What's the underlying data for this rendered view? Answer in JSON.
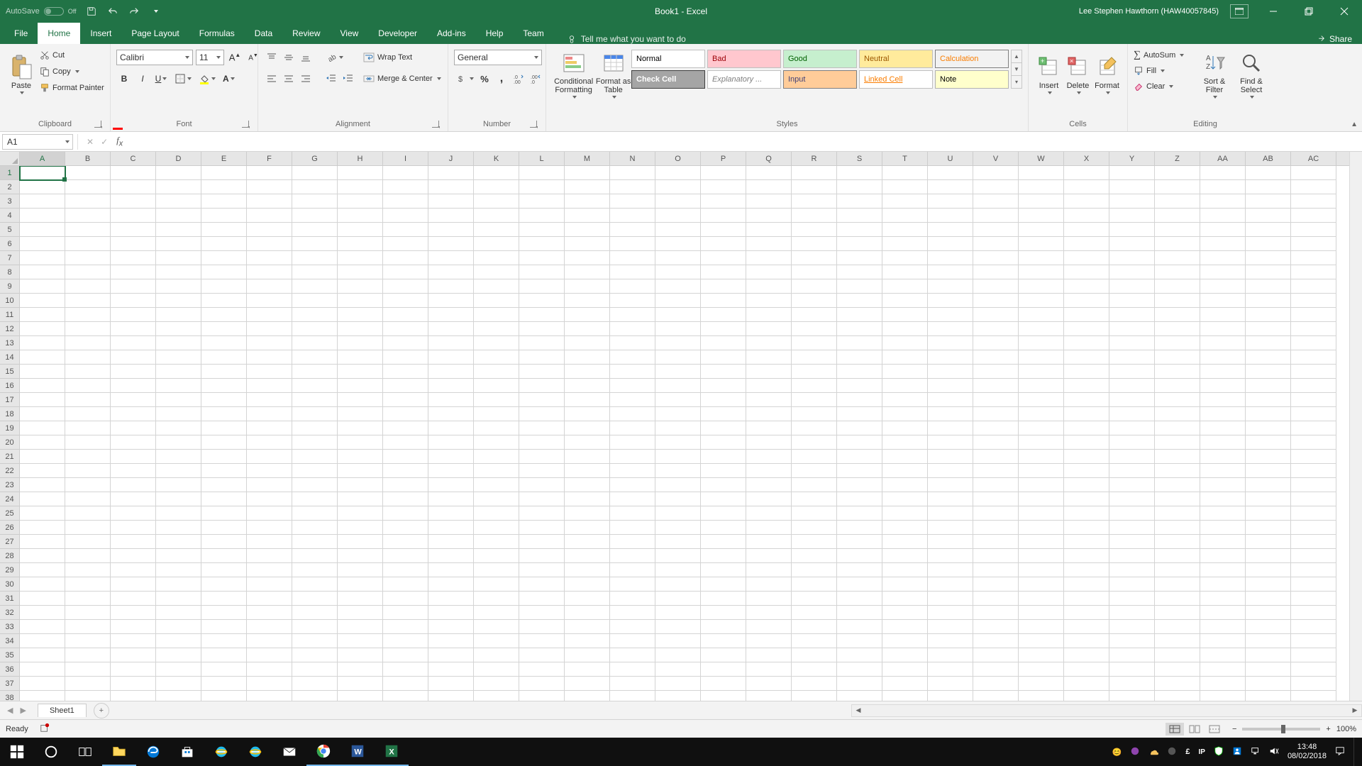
{
  "titlebar": {
    "autosave_label": "AutoSave",
    "autosave_state": "Off",
    "doc_title": "Book1 - Excel",
    "user": "Lee Stephen Hawthorn (HAW40057845)"
  },
  "tabs": {
    "file": "File",
    "items": [
      "Home",
      "Insert",
      "Page Layout",
      "Formulas",
      "Data",
      "Review",
      "View",
      "Developer",
      "Add-ins",
      "Help",
      "Team"
    ],
    "active": "Home",
    "tellme": "Tell me what you want to do",
    "share": "Share"
  },
  "ribbon": {
    "clipboard": {
      "caption": "Clipboard",
      "paste": "Paste",
      "cut": "Cut",
      "copy": "Copy",
      "painter": "Format Painter"
    },
    "font": {
      "caption": "Font",
      "name": "Calibri",
      "size": "11"
    },
    "alignment": {
      "caption": "Alignment",
      "wrap": "Wrap Text",
      "merge": "Merge & Center"
    },
    "number": {
      "caption": "Number",
      "format": "General"
    },
    "styles": {
      "caption": "Styles",
      "cond": "Conditional Formatting",
      "table": "Format as Table",
      "gallery": [
        {
          "label": "Normal",
          "bg": "#ffffff",
          "fg": "#000000",
          "border": "#bfbfbf"
        },
        {
          "label": "Bad",
          "bg": "#ffc7ce",
          "fg": "#9c0006",
          "border": "#bfbfbf"
        },
        {
          "label": "Good",
          "bg": "#c6efce",
          "fg": "#006100",
          "border": "#bfbfbf"
        },
        {
          "label": "Neutral",
          "bg": "#ffeb9c",
          "fg": "#9c5700",
          "border": "#bfbfbf"
        },
        {
          "label": "Calculation",
          "bg": "#f2f2f2",
          "fg": "#fa7d00",
          "border": "#7f7f7f"
        },
        {
          "label": "Check Cell",
          "bg": "#a5a5a5",
          "fg": "#ffffff",
          "border": "#3f3f3f",
          "bold": true
        },
        {
          "label": "Explanatory ...",
          "bg": "#ffffff",
          "fg": "#7f7f7f",
          "border": "#bfbfbf",
          "italic": true
        },
        {
          "label": "Input",
          "bg": "#ffcc99",
          "fg": "#3f3f76",
          "border": "#7f7f7f"
        },
        {
          "label": "Linked Cell",
          "bg": "#ffffff",
          "fg": "#fa7d00",
          "border": "#bfbfbf",
          "ul": "#fa7d00"
        },
        {
          "label": "Note",
          "bg": "#ffffcc",
          "fg": "#000000",
          "border": "#b2b2b2"
        }
      ]
    },
    "cells": {
      "caption": "Cells",
      "insert": "Insert",
      "delete": "Delete",
      "format": "Format"
    },
    "editing": {
      "caption": "Editing",
      "autosum": "AutoSum",
      "fill": "Fill",
      "clear": "Clear",
      "sort": "Sort & Filter",
      "find": "Find & Select"
    }
  },
  "formula_bar": {
    "name_box": "A1",
    "formula": ""
  },
  "grid": {
    "columns": [
      "A",
      "B",
      "C",
      "D",
      "E",
      "F",
      "G",
      "H",
      "I",
      "J",
      "K",
      "L",
      "M",
      "N",
      "O",
      "P",
      "Q",
      "R",
      "S",
      "T",
      "U",
      "V",
      "W",
      "X",
      "Y",
      "Z",
      "AA",
      "AB",
      "AC"
    ],
    "rows": 38,
    "active_cell": "A1"
  },
  "sheet": {
    "name": "Sheet1"
  },
  "status": {
    "ready": "Ready",
    "zoom": "100%"
  },
  "taskbar": {
    "time": "13:48",
    "date": "08/02/2018"
  }
}
